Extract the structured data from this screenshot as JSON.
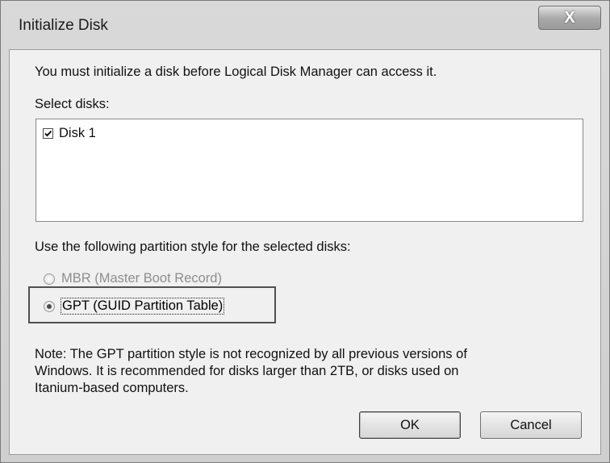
{
  "window": {
    "title": "Initialize Disk",
    "close_glyph": "X"
  },
  "intro_text": "You must initialize a disk before Logical Disk Manager can access it.",
  "select_disks_label": "Select disks:",
  "disks": [
    {
      "label": "Disk 1",
      "checked": true
    }
  ],
  "partition_style_label": "Use the following partition style for the selected disks:",
  "partition_options": [
    {
      "label": "MBR (Master Boot Record)",
      "selected": false
    },
    {
      "label": "GPT (GUID Partition Table)",
      "selected": true
    }
  ],
  "note_lines": [
    "Note: The GPT partition style is not recognized by all previous versions of",
    "Windows. It is recommended for disks larger than 2TB, or disks used on",
    "Itanium-based computers."
  ],
  "buttons": {
    "ok_label": "OK",
    "cancel_label": "Cancel"
  }
}
